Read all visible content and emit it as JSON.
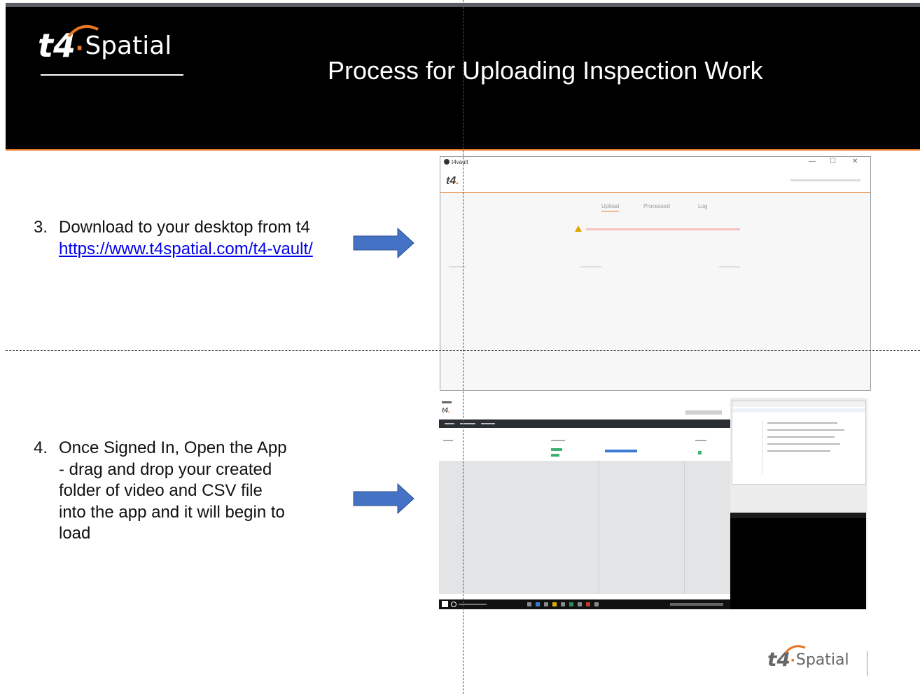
{
  "header": {
    "logo": {
      "t4": "t4",
      "dot": "·",
      "spatial": "Spatial"
    },
    "title": "Process for Uploading Inspection Work"
  },
  "steps": [
    {
      "number": "3.",
      "lines": [
        "Download to your desktop from t4"
      ],
      "link": "https://www.t4spatial.com/t4-vault/"
    },
    {
      "number": "4.",
      "lines": [
        "Once Signed In, Open the App",
        "- drag and drop your created",
        "folder of video and CSV file",
        "into the app and it will begin to",
        "load"
      ]
    }
  ],
  "screenshot1": {
    "window_title": "t4vault",
    "window_controls": [
      "—",
      "☐",
      "✕"
    ],
    "logo": {
      "t4": "t4",
      "dot": "."
    },
    "tabs": [
      "Upload",
      "Processed",
      "Log"
    ]
  },
  "screenshot2": {
    "logo": {
      "t4": "t4",
      "dot": "."
    }
  },
  "footer_logo": {
    "t4": "t4",
    "dot": "·",
    "spatial": "Spatial"
  },
  "colors": {
    "header_bg": "#000000",
    "accent": "#e87722",
    "arrow": "#4472c4",
    "link": "#0000ee"
  }
}
